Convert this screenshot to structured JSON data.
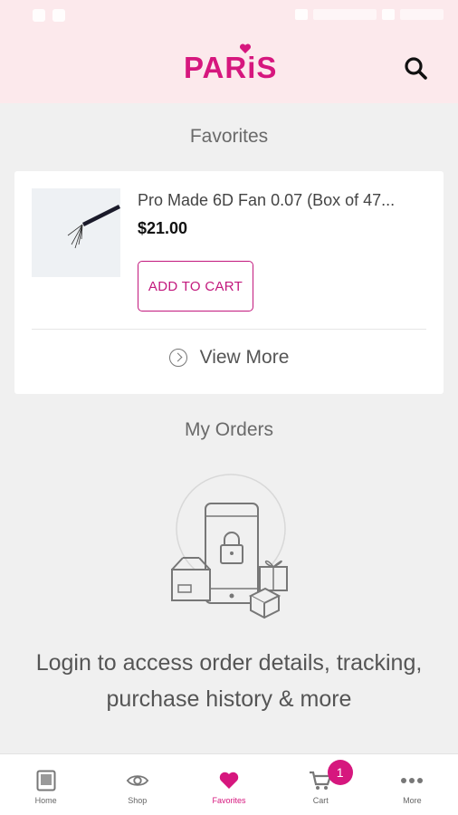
{
  "header": {
    "brand": "PARiS"
  },
  "favorites": {
    "title": "Favorites",
    "product": {
      "name": "Pro Made 6D Fan 0.07 (Box of 47...",
      "price": "$21.00",
      "add_label": "ADD TO CART"
    },
    "view_more_label": "View More"
  },
  "orders": {
    "title": "My Orders",
    "login_message": "Login to access order details, tracking, purchase history & more"
  },
  "nav": {
    "items": [
      {
        "label": "Home",
        "icon": "home-icon"
      },
      {
        "label": "Shop",
        "icon": "eye-icon"
      },
      {
        "label": "Favorites",
        "icon": "heart-icon"
      },
      {
        "label": "Cart",
        "icon": "cart-icon"
      },
      {
        "label": "More",
        "icon": "more-icon"
      }
    ],
    "cart_count": "1",
    "active_color": "#d6177e"
  }
}
